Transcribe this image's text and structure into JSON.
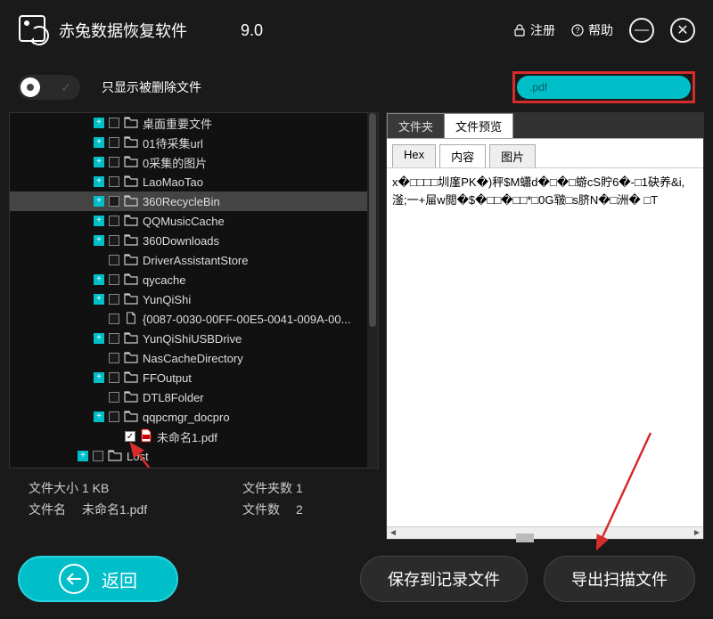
{
  "header": {
    "title": "赤兔数据恢复软件",
    "version": "9.0",
    "register": "注册",
    "help": "帮助"
  },
  "toolbar": {
    "show_deleted_only": "只显示被删除文件",
    "search_value": ".pdf"
  },
  "tree": {
    "items": [
      {
        "indent": 3,
        "expand": true,
        "checked": false,
        "icon": "folder",
        "label": "桌面重要文件",
        "selected": false
      },
      {
        "indent": 3,
        "expand": true,
        "checked": false,
        "icon": "folder",
        "label": "01待采集url",
        "selected": false
      },
      {
        "indent": 3,
        "expand": true,
        "checked": false,
        "icon": "folder",
        "label": "0采集的图片",
        "selected": false
      },
      {
        "indent": 3,
        "expand": true,
        "checked": false,
        "icon": "folder",
        "label": "LaoMaoTao",
        "selected": false
      },
      {
        "indent": 3,
        "expand": true,
        "checked": false,
        "icon": "folder",
        "label": "360RecycleBin",
        "selected": true
      },
      {
        "indent": 3,
        "expand": true,
        "checked": false,
        "icon": "folder",
        "label": "QQMusicCache",
        "selected": false
      },
      {
        "indent": 3,
        "expand": true,
        "checked": false,
        "icon": "folder",
        "label": "360Downloads",
        "selected": false
      },
      {
        "indent": 3,
        "expand": false,
        "checked": false,
        "icon": "folder",
        "label": "DriverAssistantStore",
        "selected": false
      },
      {
        "indent": 3,
        "expand": true,
        "checked": false,
        "icon": "folder",
        "label": "qycache",
        "selected": false
      },
      {
        "indent": 3,
        "expand": true,
        "checked": false,
        "icon": "folder",
        "label": "YunQiShi",
        "selected": false
      },
      {
        "indent": 3,
        "expand": false,
        "checked": false,
        "icon": "file",
        "label": "{0087-0030-00FF-00E5-0041-009A-00...",
        "selected": false
      },
      {
        "indent": 3,
        "expand": true,
        "checked": false,
        "icon": "folder",
        "label": "YunQiShiUSBDrive",
        "selected": false
      },
      {
        "indent": 3,
        "expand": false,
        "checked": false,
        "icon": "folder",
        "label": "NasCacheDirectory",
        "selected": false
      },
      {
        "indent": 3,
        "expand": true,
        "checked": false,
        "icon": "folder",
        "label": "FFOutput",
        "selected": false
      },
      {
        "indent": 3,
        "expand": false,
        "checked": false,
        "icon": "folder",
        "label": "DTL8Folder",
        "selected": false
      },
      {
        "indent": 3,
        "expand": true,
        "checked": false,
        "icon": "folder",
        "label": "qqpcmgr_docpro",
        "selected": false
      },
      {
        "indent": 4,
        "expand": false,
        "checked": true,
        "icon": "pdf",
        "label": "未命名1.pdf",
        "selected": false
      },
      {
        "indent": 2,
        "expand": true,
        "checked": false,
        "icon": "folder",
        "label": "Lost",
        "selected": false
      }
    ]
  },
  "status": {
    "size_label": "文件大小",
    "size_value": "1 KB",
    "folders_label": "文件夹数",
    "folders_value": "1",
    "name_label": "文件名",
    "name_value": "未命名1.pdf",
    "files_label": "文件数",
    "files_value": "2"
  },
  "preview": {
    "tab_folder": "文件夹",
    "tab_preview": "文件预览",
    "tab_hex": "Hex",
    "tab_content": "内容",
    "tab_image": "图片",
    "text": "x�□□□□圳廑PK�)秤$M蠨d�□�□蝣cS貯6�-□1砄养&i,滏;一+屇w閲�$�□□�□□*□0G皲□s脐N�□洲� □T"
  },
  "footer": {
    "back": "返回",
    "save_log": "保存到记录文件",
    "export": "导出扫描文件"
  }
}
